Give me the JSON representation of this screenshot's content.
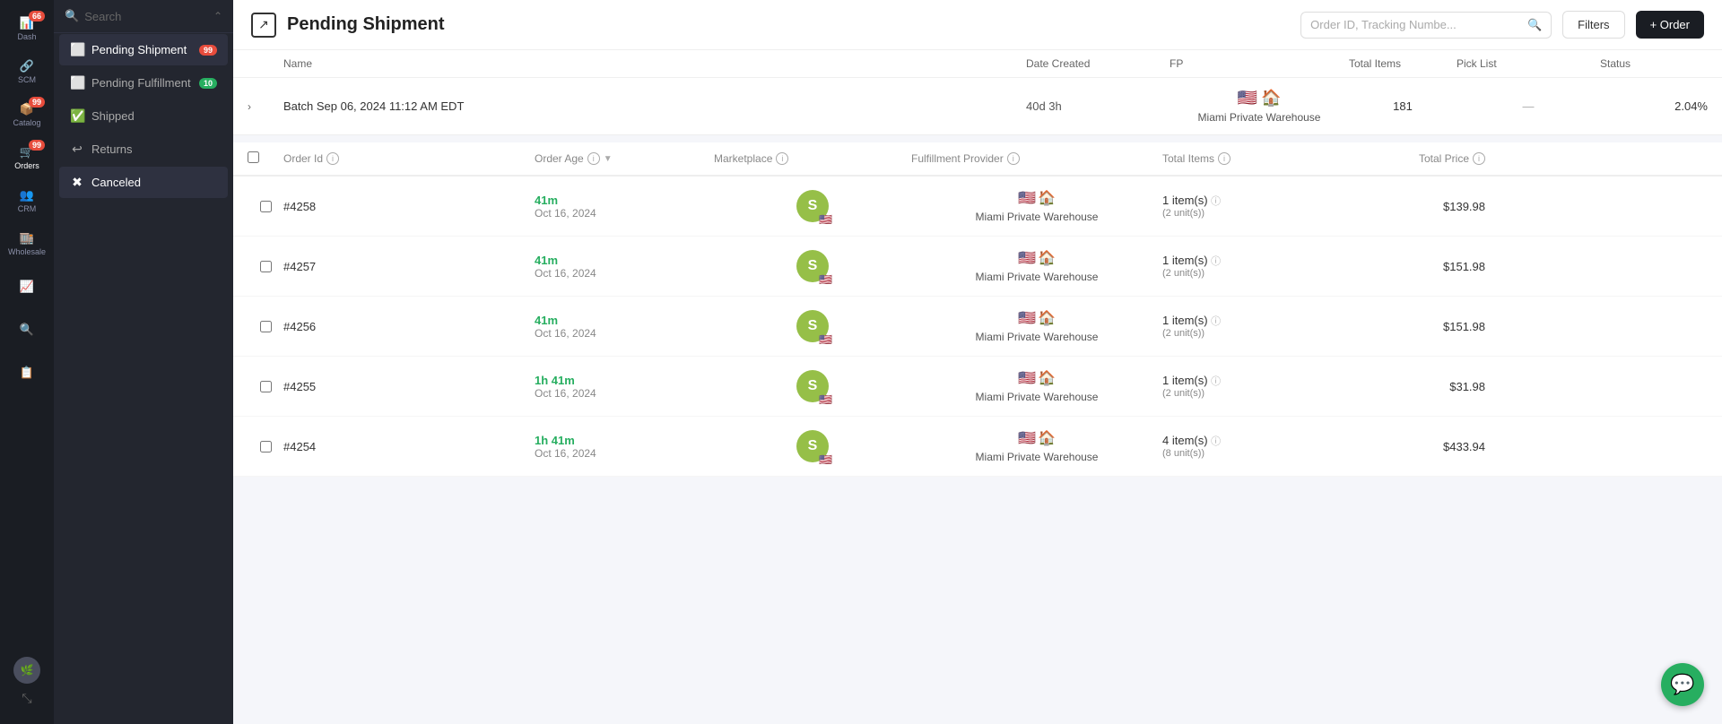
{
  "sidebar_icons": [
    {
      "name": "dash-icon",
      "icon": "📊",
      "label": "Dash",
      "badge": "66",
      "active": false
    },
    {
      "name": "scm-icon",
      "icon": "🔗",
      "label": "SCM",
      "badge": null,
      "active": false
    },
    {
      "name": "catalog-icon",
      "icon": "📦",
      "label": "Catalog",
      "badge": "99",
      "active": false
    },
    {
      "name": "orders-icon",
      "icon": "🛒",
      "label": "Orders",
      "badge": "99",
      "active": true
    },
    {
      "name": "crm-icon",
      "icon": "👥",
      "label": "CRM",
      "badge": null,
      "active": false
    },
    {
      "name": "wholesale-icon",
      "icon": "🏬",
      "label": "Wholesale",
      "badge": null,
      "active": false
    },
    {
      "name": "analytics-icon",
      "icon": "📈",
      "label": "",
      "badge": null,
      "active": false
    },
    {
      "name": "search-icon",
      "icon": "🔍",
      "label": "",
      "badge": null,
      "active": false
    },
    {
      "name": "reports-icon",
      "icon": "📋",
      "label": "",
      "badge": null,
      "active": false
    }
  ],
  "nav": {
    "search_placeholder": "Search",
    "items": [
      {
        "label": "Pending Shipment",
        "icon": "⬜",
        "badge": "99",
        "badge_color": "red",
        "active": true
      },
      {
        "label": "Pending Fulfillment",
        "icon": "⬜",
        "badge": "10",
        "badge_color": "green",
        "active": false
      },
      {
        "label": "Shipped",
        "icon": "✅",
        "badge": null,
        "active": false
      },
      {
        "label": "Returns",
        "icon": "↩",
        "badge": null,
        "active": false
      },
      {
        "label": "Canceled",
        "icon": "✖",
        "badge": null,
        "active": false
      }
    ]
  },
  "header": {
    "title": "Pending Shipment",
    "search_placeholder": "Order ID, Tracking Numbe...",
    "filters_label": "Filters",
    "order_label": "+ Order"
  },
  "batch": {
    "col_name": "Name",
    "col_date": "Date Created",
    "col_fp": "FP",
    "col_items": "Total Items",
    "col_picklist": "Pick List",
    "col_status": "Status",
    "name": "Batch Sep 06, 2024 11:12 AM EDT",
    "age": "40d 3h",
    "fp_flag": "🇺🇸",
    "fp_warehouse_label": "Miami Private Warehouse",
    "items": "181",
    "picklist": "—",
    "status": "2.04%"
  },
  "table": {
    "col_checkbox": "",
    "col_order_id": "Order Id",
    "col_order_age": "Order Age",
    "col_marketplace": "Marketplace",
    "col_fp": "Fulfillment Provider",
    "col_items": "Total Items",
    "col_price": "Total Price",
    "orders": [
      {
        "id": "#4258",
        "age": "41m",
        "date": "Oct 16, 2024",
        "fp_label": "Miami Private Warehouse",
        "items": "1 item(s)",
        "units": "(2 unit(s))",
        "price": "$139.98"
      },
      {
        "id": "#4257",
        "age": "41m",
        "date": "Oct 16, 2024",
        "fp_label": "Miami Private Warehouse",
        "items": "1 item(s)",
        "units": "(2 unit(s))",
        "price": "$151.98"
      },
      {
        "id": "#4256",
        "age": "41m",
        "date": "Oct 16, 2024",
        "fp_label": "Miami Private Warehouse",
        "items": "1 item(s)",
        "units": "(2 unit(s))",
        "price": "$151.98"
      },
      {
        "id": "#4255",
        "age": "1h 41m",
        "date": "Oct 16, 2024",
        "fp_label": "Miami Private Warehouse",
        "items": "1 item(s)",
        "units": "(2 unit(s))",
        "price": "$31.98"
      },
      {
        "id": "#4254",
        "age": "1h 41m",
        "date": "Oct 16, 2024",
        "fp_label": "Miami Private Warehouse",
        "items": "4 item(s)",
        "units": "(8 unit(s))",
        "price": "$433.94"
      }
    ]
  },
  "colors": {
    "age_green": "#27ae60",
    "badge_red": "#e74c3c",
    "sidebar_bg": "#1a1d23",
    "nav_bg": "#23262f"
  }
}
